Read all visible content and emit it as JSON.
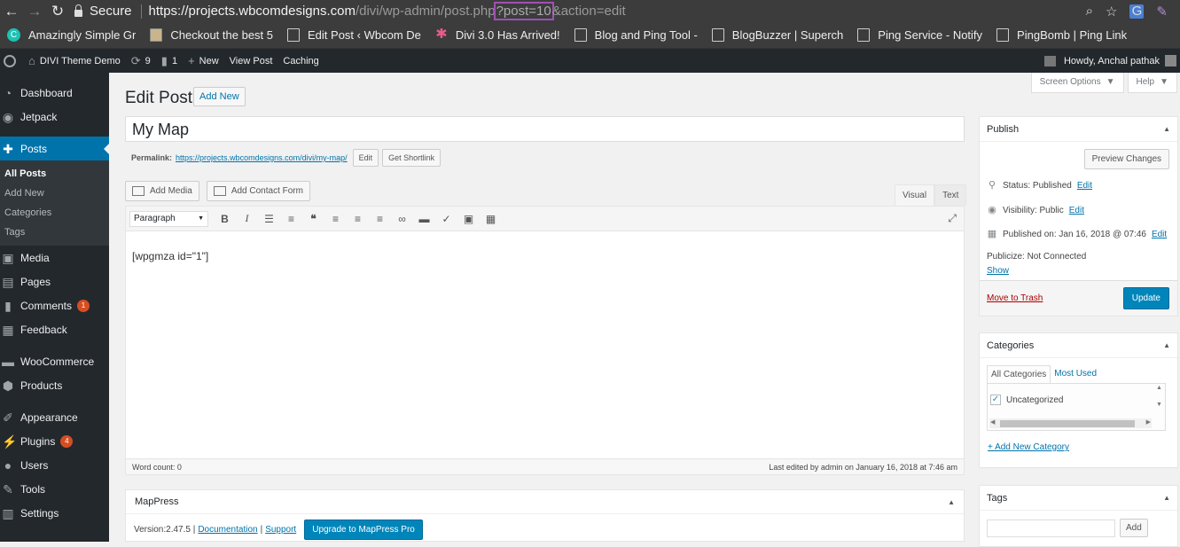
{
  "browser": {
    "secure_label": "Secure",
    "url_host": "https://projects.wbcomdesigns.com",
    "url_path": "/divi/wp-admin/post.php",
    "url_highlight": "?post=10",
    "url_rest": "&action=edit"
  },
  "bookmarks": [
    {
      "label": "Amazingly Simple Gr",
      "icon": "c-logo-icon"
    },
    {
      "label": "Checkout the best 5",
      "icon": "image-icon"
    },
    {
      "label": "Edit Post ‹ Wbcom De",
      "icon": "page-icon"
    },
    {
      "label": "Divi 3.0 Has Arrived!",
      "icon": "star-icon"
    },
    {
      "label": "Blog and Ping Tool -",
      "icon": "page-icon"
    },
    {
      "label": "BlogBuzzer | Superch",
      "icon": "page-icon"
    },
    {
      "label": "Ping Service - Notify",
      "icon": "page-icon"
    },
    {
      "label": "PingBomb | Ping Link",
      "icon": "page-icon"
    }
  ],
  "adminbar": {
    "site_name": "DIVI Theme Demo",
    "updates_count": "9",
    "comments_count": "1",
    "new_label": "New",
    "view_post": "View Post",
    "caching": "Caching",
    "howdy": "Howdy, Anchal pathak"
  },
  "sidebar": {
    "dashboard": "Dashboard",
    "jetpack": "Jetpack",
    "posts": "Posts",
    "all_posts": "All Posts",
    "add_new": "Add New",
    "categories": "Categories",
    "tags": "Tags",
    "media": "Media",
    "pages": "Pages",
    "comments": "Comments",
    "comments_badge": "1",
    "feedback": "Feedback",
    "woocommerce": "WooCommerce",
    "products": "Products",
    "appearance": "Appearance",
    "plugins": "Plugins",
    "plugins_badge": "4",
    "users": "Users",
    "tools": "Tools",
    "settings": "Settings"
  },
  "main": {
    "page_title": "Edit Post",
    "add_new": "Add New",
    "screen_options": "Screen Options",
    "help": "Help",
    "post_title": "My Map",
    "permalink_label": "Permalink:",
    "permalink_url": "https://projects.wbcomdesigns.com/divi/my-map/",
    "edit": "Edit",
    "get_shortlink": "Get Shortlink",
    "add_media": "Add Media",
    "add_contact_form": "Add Contact Form",
    "tab_visual": "Visual",
    "tab_text": "Text",
    "format_select": "Paragraph",
    "content": "[wpgmza id=\"1\"]",
    "word_count": "Word count: 0",
    "last_edited": "Last edited by admin on January 16, 2018 at 7:46 am"
  },
  "mappress": {
    "title": "MapPress",
    "version": "Version:2.47.5 |",
    "documentation": "Documentation",
    "divider": "|",
    "support": "Support",
    "upgrade": "Upgrade to MapPress Pro"
  },
  "publish": {
    "title": "Publish",
    "preview_changes": "Preview Changes",
    "status_label": "Status: Published",
    "visibility_label": "Visibility: Public",
    "published_on": "Published on: Jan 16, 2018 @ 07:46",
    "edit": "Edit",
    "publicize": "Publicize: Not Connected",
    "show": "Show",
    "move_to_trash": "Move to Trash",
    "update": "Update"
  },
  "categories_box": {
    "title": "Categories",
    "tab_all": "All Categories",
    "tab_used": "Most Used",
    "item": "Uncategorized",
    "add_new": "+ Add New Category"
  },
  "tags_box": {
    "title": "Tags",
    "add": "Add"
  }
}
